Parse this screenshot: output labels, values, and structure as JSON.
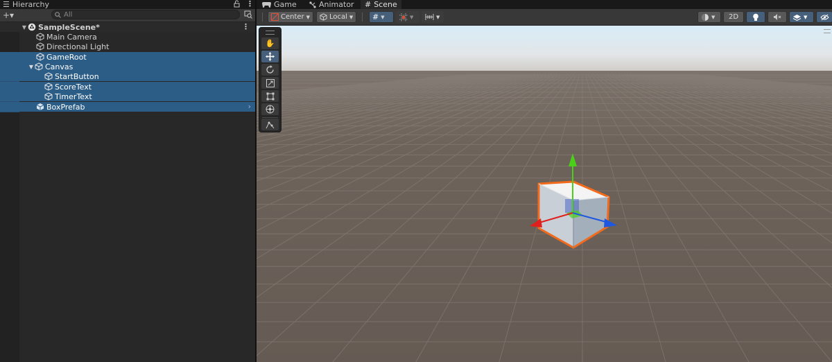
{
  "hierarchy": {
    "tab_label": "Hierarchy",
    "add_label": "+▾",
    "search_placeholder": "All",
    "scene_name": "SampleScene*",
    "items": [
      {
        "label": "Main Camera"
      },
      {
        "label": "Directional Light"
      },
      {
        "label": "GameRoot"
      },
      {
        "label": "Canvas"
      },
      {
        "label": "StartButton"
      },
      {
        "label": "ScoreText"
      },
      {
        "label": "TimerText"
      },
      {
        "label": "BoxPrefab"
      }
    ]
  },
  "scene_tabs": [
    {
      "label": "Game"
    },
    {
      "label": "Animator"
    },
    {
      "label": "Scene"
    }
  ],
  "scene_toolbar": {
    "pivot_label": "Center",
    "space_label": "Local",
    "mode_2d_label": "2D"
  },
  "colors": {
    "selection": "#2c5d87",
    "accent_button": "#46607c",
    "sky_top": "#d8ecf8",
    "ground": "#6a5f58",
    "highlight_outline": "#f26a1b",
    "axis_x": "#e0201c",
    "axis_y": "#4bd01a",
    "axis_z": "#1f58e0"
  }
}
